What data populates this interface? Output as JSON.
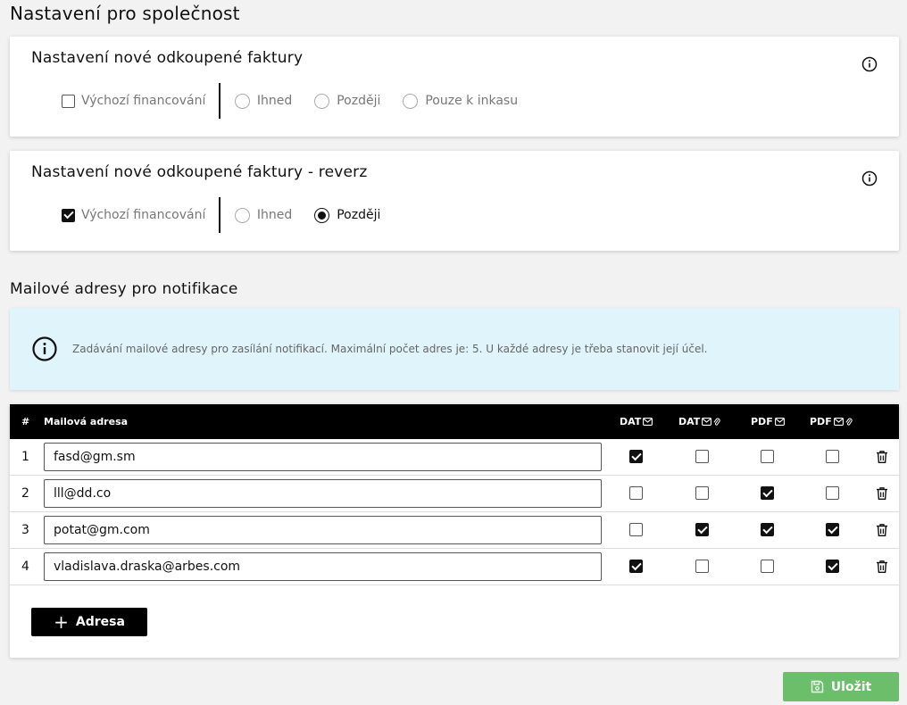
{
  "page": {
    "title": "Nastavení pro společnost"
  },
  "section1": {
    "title": "Nastavení nové odkoupené faktury",
    "checkbox_label": "Výchozí financování",
    "checkbox_checked": false,
    "radios": [
      "Ihned",
      "Později",
      "Pouze k inkasu"
    ],
    "selected": null
  },
  "section2": {
    "title": "Nastavení nové odkoupené faktury - reverz",
    "checkbox_label": "Výchozí financování",
    "checkbox_checked": true,
    "radios": [
      "Ihned",
      "Později"
    ],
    "selected": "Později"
  },
  "mail": {
    "title": "Mailové adresy pro notifikace",
    "info": "Zadávání mailové adresy pro zasílání notifikací. Maximální počet adres je: 5. U každé adresy je třeba stanovit její účel.",
    "headers": {
      "num": "#",
      "email": "Mailová adresa",
      "c1": "DAT",
      "c2": "DAT",
      "c3": "PDF",
      "c4": "PDF"
    },
    "header_icons": [
      "envelope-icon",
      "envelope-paperclip-icon",
      "envelope-icon",
      "envelope-paperclip-icon"
    ],
    "rows": [
      {
        "num": "1",
        "email": "fasd@gm.sm",
        "checks": [
          true,
          false,
          false,
          false
        ]
      },
      {
        "num": "2",
        "email": "lll@dd.co",
        "checks": [
          false,
          false,
          true,
          false
        ]
      },
      {
        "num": "3",
        "email": "potat@gm.com",
        "checks": [
          false,
          true,
          true,
          true
        ]
      },
      {
        "num": "4",
        "email": "vladislava.draska@arbes.com",
        "checks": [
          true,
          false,
          false,
          true
        ]
      }
    ],
    "add_label": "Adresa"
  },
  "save_label": "Uložit",
  "colors": {
    "save": "#6cbf6a",
    "banner": "#e0f4fb",
    "header": "#000000"
  }
}
